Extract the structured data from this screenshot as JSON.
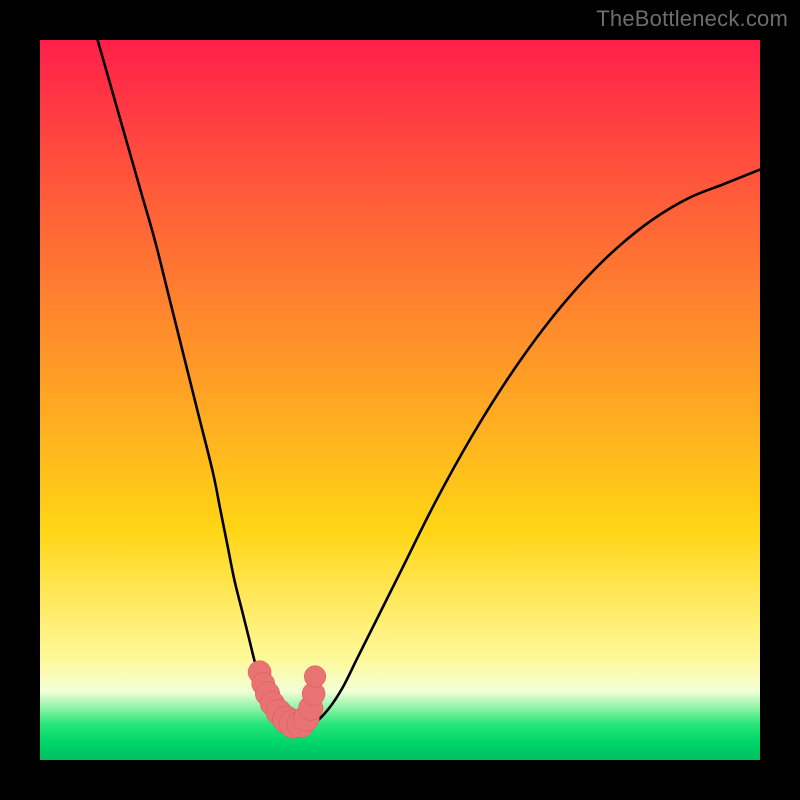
{
  "watermark": "TheBottleneck.com",
  "colors": {
    "frame": "#000000",
    "curve": "#000000",
    "beads": "#e97272",
    "bead_stroke": "#d65a5a",
    "grad_top": "#ff1f4a",
    "grad_upper": "#ff5a3a",
    "grad_mid": "#ffd515",
    "grad_lower": "#fff99a",
    "grad_pale": "#f2ffd6",
    "grad_base_green": "#29e77a",
    "grad_base_green2": "#00d66a",
    "grad_base_green3": "#00c060"
  },
  "chart_data": {
    "type": "line",
    "title": "",
    "xlabel": "",
    "ylabel": "",
    "xlim": [
      0,
      100
    ],
    "ylim": [
      0,
      100
    ],
    "series": [
      {
        "name": "v-curve",
        "x": [
          8,
          10,
          12,
          14,
          16,
          18,
          20,
          22,
          24,
          25,
          26,
          27,
          28,
          29,
          30,
          31,
          32,
          33,
          34,
          35,
          36,
          38,
          40,
          42,
          44,
          46,
          50,
          55,
          60,
          65,
          70,
          75,
          80,
          85,
          90,
          95,
          100
        ],
        "y": [
          100,
          93,
          86,
          79,
          72,
          64,
          56,
          48,
          40,
          35,
          30,
          25,
          21,
          17,
          13,
          10,
          7,
          5,
          4,
          4,
          4,
          5,
          7,
          10,
          14,
          18,
          26,
          36,
          45,
          53,
          60,
          66,
          71,
          75,
          78,
          80,
          82
        ]
      }
    ],
    "beads": {
      "name": "highlight-beads",
      "x": [
        30.5,
        31.0,
        31.6,
        32.3,
        33.2,
        34.2,
        35.2,
        36.2,
        37.0,
        37.6,
        38.0,
        38.2
      ],
      "y": [
        12.2,
        10.6,
        9.2,
        7.8,
        6.6,
        5.6,
        5.0,
        5.0,
        5.8,
        7.2,
        9.2,
        11.6
      ],
      "r": [
        1.6,
        1.6,
        1.7,
        1.7,
        1.8,
        1.9,
        2.0,
        1.9,
        1.8,
        1.7,
        1.6,
        1.5
      ]
    },
    "gradient_bands_y": {
      "red_to_orange": 35,
      "orange_to_yellow": 68,
      "yellow_to_pale": 86,
      "pale_to_green": 95
    }
  }
}
